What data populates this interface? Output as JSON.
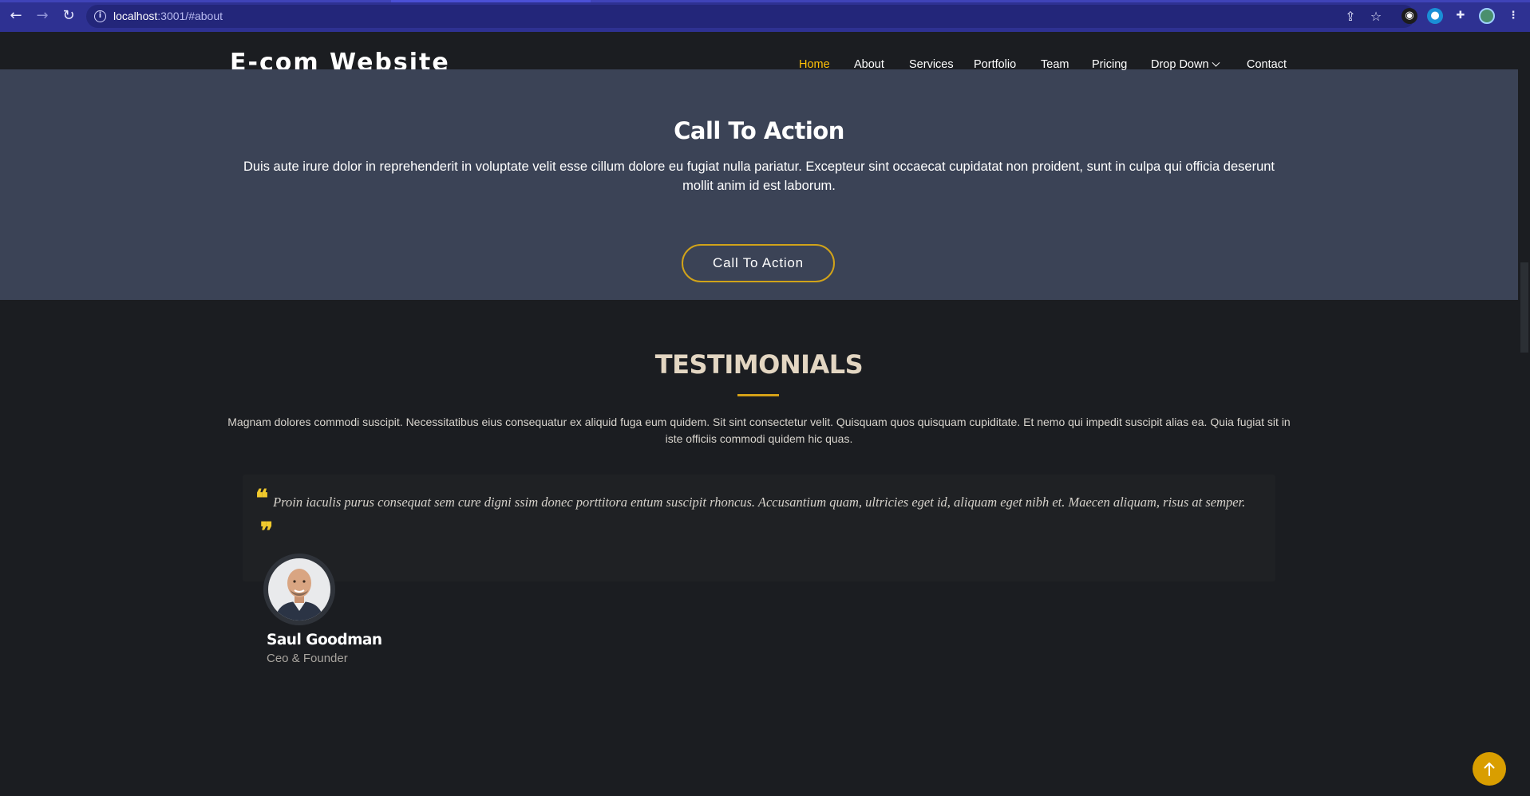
{
  "browser": {
    "url_host": "localhost",
    "url_rest": ":3001/#about",
    "icons": [
      "back-icon",
      "forward-icon",
      "reload-icon",
      "info-icon",
      "share-icon",
      "star-icon",
      "extension-icon",
      "puzzle-icon",
      "profile-icon",
      "menu-icon"
    ]
  },
  "header": {
    "logo": "E-com Website",
    "nav": [
      {
        "label": "Home",
        "active": true
      },
      {
        "label": "About"
      },
      {
        "label": "Services"
      },
      {
        "label": "Portfolio"
      },
      {
        "label": "Team"
      },
      {
        "label": "Pricing"
      },
      {
        "label": "Drop Down"
      },
      {
        "label": "Contact"
      }
    ]
  },
  "cta": {
    "title": "Call To Action",
    "text": "Duis aute irure dolor in reprehenderit in voluptate velit esse cillum dolore eu fugiat nulla pariatur. Excepteur sint occaecat cupidatat non proident, sunt in culpa qui officia deserunt mollit anim id est laborum.",
    "button": "Call To Action"
  },
  "testimonials": {
    "title": "TESTIMONIALS",
    "description": "Magnam dolores commodi suscipit. Necessitatibus eius consequatur ex aliquid fuga eum quidem. Sit sint consectetur velit. Quisquam quos quisquam cupiditate. Et nemo qui impedit suscipit alias ea. Quia fugiat sit in iste officiis commodi quidem hic quas.",
    "items": [
      {
        "quote": "Proin iaculis purus consequat sem cure digni ssim donec porttitora entum suscipit rhoncus. Accusantium quam, ultricies eget id, aliquam eget nibh et. Maecen aliquam, risus at semper.",
        "name": "Saul Goodman",
        "role": "Ceo & Founder"
      }
    ]
  },
  "colors": {
    "browser_bar": "#2e3192",
    "accent": "#ffc107",
    "cta_bg": "#3b4356",
    "page_bg": "#1b1d21",
    "back_to_top": "#d99e00"
  }
}
